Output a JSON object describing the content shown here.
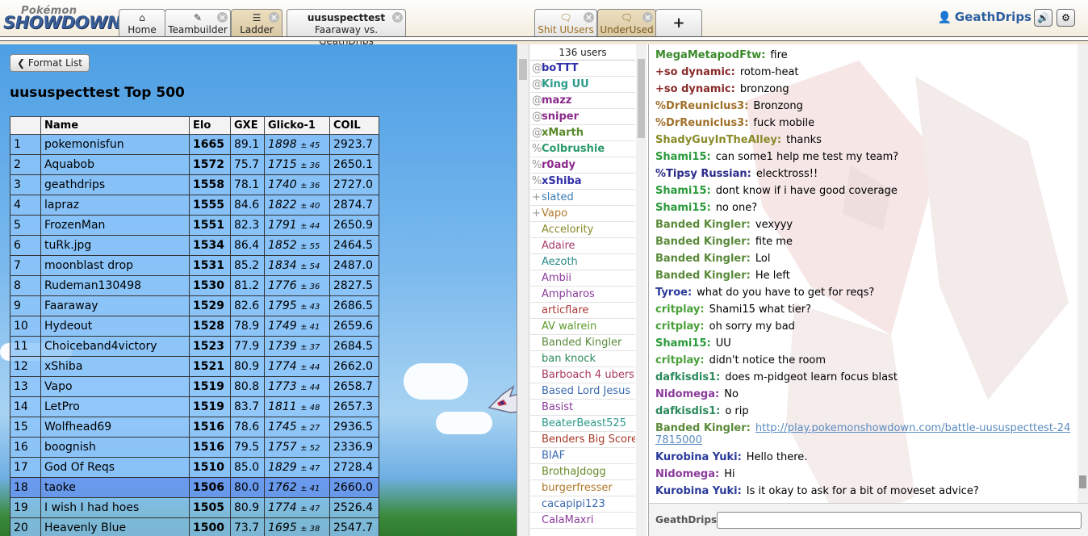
{
  "header": {
    "logo_top": "Pokémon",
    "logo_main": "SHOWDOWN!",
    "tabs": [
      {
        "label": "Home",
        "icon": "home-icon"
      },
      {
        "label": "Teambuilder",
        "icon": "edit-icon"
      },
      {
        "label": "Ladder",
        "icon": "list-icon"
      }
    ],
    "battle_tab": {
      "title": "uususpecttest",
      "subtitle": "Faaraway vs. GeathDrips"
    },
    "room_tabs": [
      {
        "label": "Shit UUsers",
        "icon": "chat-icon"
      },
      {
        "label": "UnderUsed",
        "icon": "chat-icon"
      }
    ],
    "new_tab_label": "+",
    "username": "GeathDrips",
    "close_glyph": "×"
  },
  "ladder": {
    "format_list_label": "Format List",
    "title": "uususpecttest Top 500",
    "columns": [
      "",
      "Name",
      "Elo",
      "GXE",
      "Glicko-1",
      "COIL"
    ],
    "rows": [
      {
        "rank": "1",
        "name": "pokemonisfun",
        "elo": "1665",
        "gxe": "89.1",
        "glicko": "1898",
        "dev": "± 45",
        "coil": "2923.7"
      },
      {
        "rank": "2",
        "name": "Aquabob",
        "elo": "1572",
        "gxe": "75.7",
        "glicko": "1715",
        "dev": "± 36",
        "coil": "2650.1"
      },
      {
        "rank": "3",
        "name": "geathdrips",
        "elo": "1558",
        "gxe": "78.1",
        "glicko": "1740",
        "dev": "± 36",
        "coil": "2727.0"
      },
      {
        "rank": "4",
        "name": "lapraz",
        "elo": "1555",
        "gxe": "84.6",
        "glicko": "1822",
        "dev": "± 40",
        "coil": "2874.7"
      },
      {
        "rank": "5",
        "name": "FrozenMan",
        "elo": "1551",
        "gxe": "82.3",
        "glicko": "1791",
        "dev": "± 44",
        "coil": "2650.9"
      },
      {
        "rank": "6",
        "name": "tuRk.jpg",
        "elo": "1534",
        "gxe": "86.4",
        "glicko": "1852",
        "dev": "± 55",
        "coil": "2464.5"
      },
      {
        "rank": "7",
        "name": "moonblast drop",
        "elo": "1531",
        "gxe": "85.2",
        "glicko": "1834",
        "dev": "± 54",
        "coil": "2487.0"
      },
      {
        "rank": "8",
        "name": "Rudeman130498",
        "elo": "1530",
        "gxe": "81.2",
        "glicko": "1776",
        "dev": "± 36",
        "coil": "2827.5"
      },
      {
        "rank": "9",
        "name": "Faaraway",
        "elo": "1529",
        "gxe": "82.6",
        "glicko": "1795",
        "dev": "± 43",
        "coil": "2686.5"
      },
      {
        "rank": "10",
        "name": "Hydeout",
        "elo": "1528",
        "gxe": "78.9",
        "glicko": "1749",
        "dev": "± 41",
        "coil": "2659.6"
      },
      {
        "rank": "11",
        "name": "Choiceband4victory",
        "elo": "1523",
        "gxe": "77.9",
        "glicko": "1739",
        "dev": "± 37",
        "coil": "2684.5"
      },
      {
        "rank": "12",
        "name": "xShiba",
        "elo": "1521",
        "gxe": "80.9",
        "glicko": "1774",
        "dev": "± 44",
        "coil": "2662.0"
      },
      {
        "rank": "13",
        "name": "Vapo",
        "elo": "1519",
        "gxe": "80.8",
        "glicko": "1773",
        "dev": "± 44",
        "coil": "2658.7"
      },
      {
        "rank": "14",
        "name": "LetPro",
        "elo": "1519",
        "gxe": "83.7",
        "glicko": "1811",
        "dev": "± 48",
        "coil": "2657.3"
      },
      {
        "rank": "15",
        "name": "Wolfhead69",
        "elo": "1516",
        "gxe": "78.6",
        "glicko": "1745",
        "dev": "± 27",
        "coil": "2936.5"
      },
      {
        "rank": "16",
        "name": "boognish",
        "elo": "1516",
        "gxe": "79.5",
        "glicko": "1757",
        "dev": "± 52",
        "coil": "2336.9"
      },
      {
        "rank": "17",
        "name": "God Of Reqs",
        "elo": "1510",
        "gxe": "85.0",
        "glicko": "1829",
        "dev": "± 47",
        "coil": "2728.4"
      },
      {
        "rank": "18",
        "name": "taoke",
        "elo": "1506",
        "gxe": "80.0",
        "glicko": "1762",
        "dev": "± 41",
        "coil": "2660.0"
      },
      {
        "rank": "19",
        "name": "I wish I had hoes",
        "elo": "1505",
        "gxe": "80.9",
        "glicko": "1774",
        "dev": "± 47",
        "coil": "2526.4"
      },
      {
        "rank": "20",
        "name": "Heavenly Blue",
        "elo": "1500",
        "gxe": "73.7",
        "glicko": "1695",
        "dev": "± 38",
        "coil": "2547.7"
      }
    ]
  },
  "userlist": {
    "count": "136 users",
    "users": [
      {
        "group": "@",
        "name": "boTTT",
        "color": "#2f2fa8",
        "staff": true
      },
      {
        "group": "@",
        "name": "King UU",
        "color": "#2a9a8a",
        "staff": true
      },
      {
        "group": "@",
        "name": "mazz",
        "color": "#8b2a8b",
        "staff": true
      },
      {
        "group": "@",
        "name": "sniper",
        "color": "#8b2a8b",
        "staff": true
      },
      {
        "group": "@",
        "name": "xMarth",
        "color": "#5a8a2a",
        "staff": true
      },
      {
        "group": "%",
        "name": "Colbrushie",
        "color": "#2a9a6a",
        "staff": true
      },
      {
        "group": "%",
        "name": "r0ady",
        "color": "#8b2a8b",
        "staff": true
      },
      {
        "group": "%",
        "name": "xShiba",
        "color": "#2f2fa8",
        "staff": true
      },
      {
        "group": "+",
        "name": "slated",
        "color": "#3a7ab0",
        "staff": false
      },
      {
        "group": "+",
        "name": "Vapo",
        "color": "#b0782a",
        "staff": false
      },
      {
        "group": "",
        "name": "Accelority",
        "color": "#8a8a2a",
        "staff": false
      },
      {
        "group": "",
        "name": "Adaire",
        "color": "#a83a6a",
        "staff": false
      },
      {
        "group": "",
        "name": "Aezoth",
        "color": "#2a8a8a",
        "staff": false
      },
      {
        "group": "",
        "name": "Ambii",
        "color": "#8b3a9b",
        "staff": false
      },
      {
        "group": "",
        "name": "Ampharos",
        "color": "#8b3a9b",
        "staff": false
      },
      {
        "group": "",
        "name": "articflare",
        "color": "#a83a3a",
        "staff": false
      },
      {
        "group": "",
        "name": "AV walrein",
        "color": "#5a9a2a",
        "staff": false
      },
      {
        "group": "",
        "name": "Banded Kingler",
        "color": "#5a8a3a",
        "staff": false
      },
      {
        "group": "",
        "name": "ban knock",
        "color": "#2a8a5a",
        "staff": false
      },
      {
        "group": "",
        "name": "Barboach 4 ubers",
        "color": "#a83a5a",
        "staff": false
      },
      {
        "group": "",
        "name": "Based Lord Jesus",
        "color": "#3a6ab0",
        "staff": false
      },
      {
        "group": "",
        "name": "Basist",
        "color": "#8b3a9b",
        "staff": false
      },
      {
        "group": "",
        "name": "BeaterBeast525",
        "color": "#2a9a8a",
        "staff": false
      },
      {
        "group": "",
        "name": "Benders Big Score",
        "color": "#a83a2a",
        "staff": false
      },
      {
        "group": "",
        "name": "BIAF",
        "color": "#3a6ab0",
        "staff": false
      },
      {
        "group": "",
        "name": "BrothaJdogg",
        "color": "#6a8a2a",
        "staff": false
      },
      {
        "group": "",
        "name": "burgerfresser",
        "color": "#b0782a",
        "staff": false
      },
      {
        "group": "",
        "name": "cacapipi123",
        "color": "#3a6ab0",
        "staff": false
      },
      {
        "group": "",
        "name": "CalaMaxri",
        "color": "#8b3a9b",
        "staff": false
      }
    ]
  },
  "chat": {
    "messages": [
      {
        "user": "MegaMetapodFtw:",
        "color": "#3a8a2a",
        "text": "fire"
      },
      {
        "user": "+so dynamic:",
        "color": "#8a2a2a",
        "text": "rotom-heat"
      },
      {
        "user": "+so dynamic:",
        "color": "#8a2a2a",
        "text": "bronzong"
      },
      {
        "user": "%DrReuniclus3:",
        "color": "#a0702a",
        "text": "Bronzong"
      },
      {
        "user": "%DrReuniclus3:",
        "color": "#a0702a",
        "text": "fuck mobile"
      },
      {
        "user": "ShadyGuyInTheAlley:",
        "color": "#8a8a2a",
        "text": "thanks"
      },
      {
        "user": "Shami15:",
        "color": "#2a9a3a",
        "text": "can some1 help me test my team?"
      },
      {
        "user": "%Tipsy Russian:",
        "color": "#2a2a8a",
        "text": "elecktross!!"
      },
      {
        "user": "Shami15:",
        "color": "#2a9a3a",
        "text": "dont know if i have good coverage"
      },
      {
        "user": "Shami15:",
        "color": "#2a9a3a",
        "text": "no one?"
      },
      {
        "user": "Banded Kingler:",
        "color": "#5a8a3a",
        "text": "vexyyy"
      },
      {
        "user": "Banded Kingler:",
        "color": "#5a8a3a",
        "text": "fite me"
      },
      {
        "user": "Banded Kingler:",
        "color": "#5a8a3a",
        "text": "Lol"
      },
      {
        "user": "Banded Kingler:",
        "color": "#5a8a3a",
        "text": "He left"
      },
      {
        "user": "Tyroe:",
        "color": "#2a3a9a",
        "text": "what do you have to get for reqs?"
      },
      {
        "user": "critplay:",
        "color": "#4aa03a",
        "text": "Shami15 what tier?"
      },
      {
        "user": "critplay:",
        "color": "#4aa03a",
        "text": "oh sorry my bad"
      },
      {
        "user": "Shami15:",
        "color": "#2a9a3a",
        "text": "UU"
      },
      {
        "user": "critplay:",
        "color": "#4aa03a",
        "text": "didn't notice the room"
      },
      {
        "user": "dafkisdis1:",
        "color": "#2a8a5a",
        "text": "does m-pidgeot learn focus blast"
      },
      {
        "user": "Nidomega:",
        "color": "#8b3a9b",
        "text": "No"
      },
      {
        "user": "dafkisdis1:",
        "color": "#2a8a5a",
        "text": "o rip"
      },
      {
        "user": "Banded Kingler:",
        "color": "#5a8a3a",
        "link": "http://play.pokemonshowdown.com/battle-uususpecttest-247815000"
      },
      {
        "user": "Kurobina Yuki:",
        "color": "#2a3a9a",
        "text": "Hello there."
      },
      {
        "user": "Nidomega:",
        "color": "#8b3a9b",
        "text": "Hi"
      },
      {
        "user": "Kurobina Yuki:",
        "color": "#2a3a9a",
        "text": "Is it okay to ask for a bit of moveset advice?"
      }
    ],
    "input_user": "GeathDrips:"
  }
}
